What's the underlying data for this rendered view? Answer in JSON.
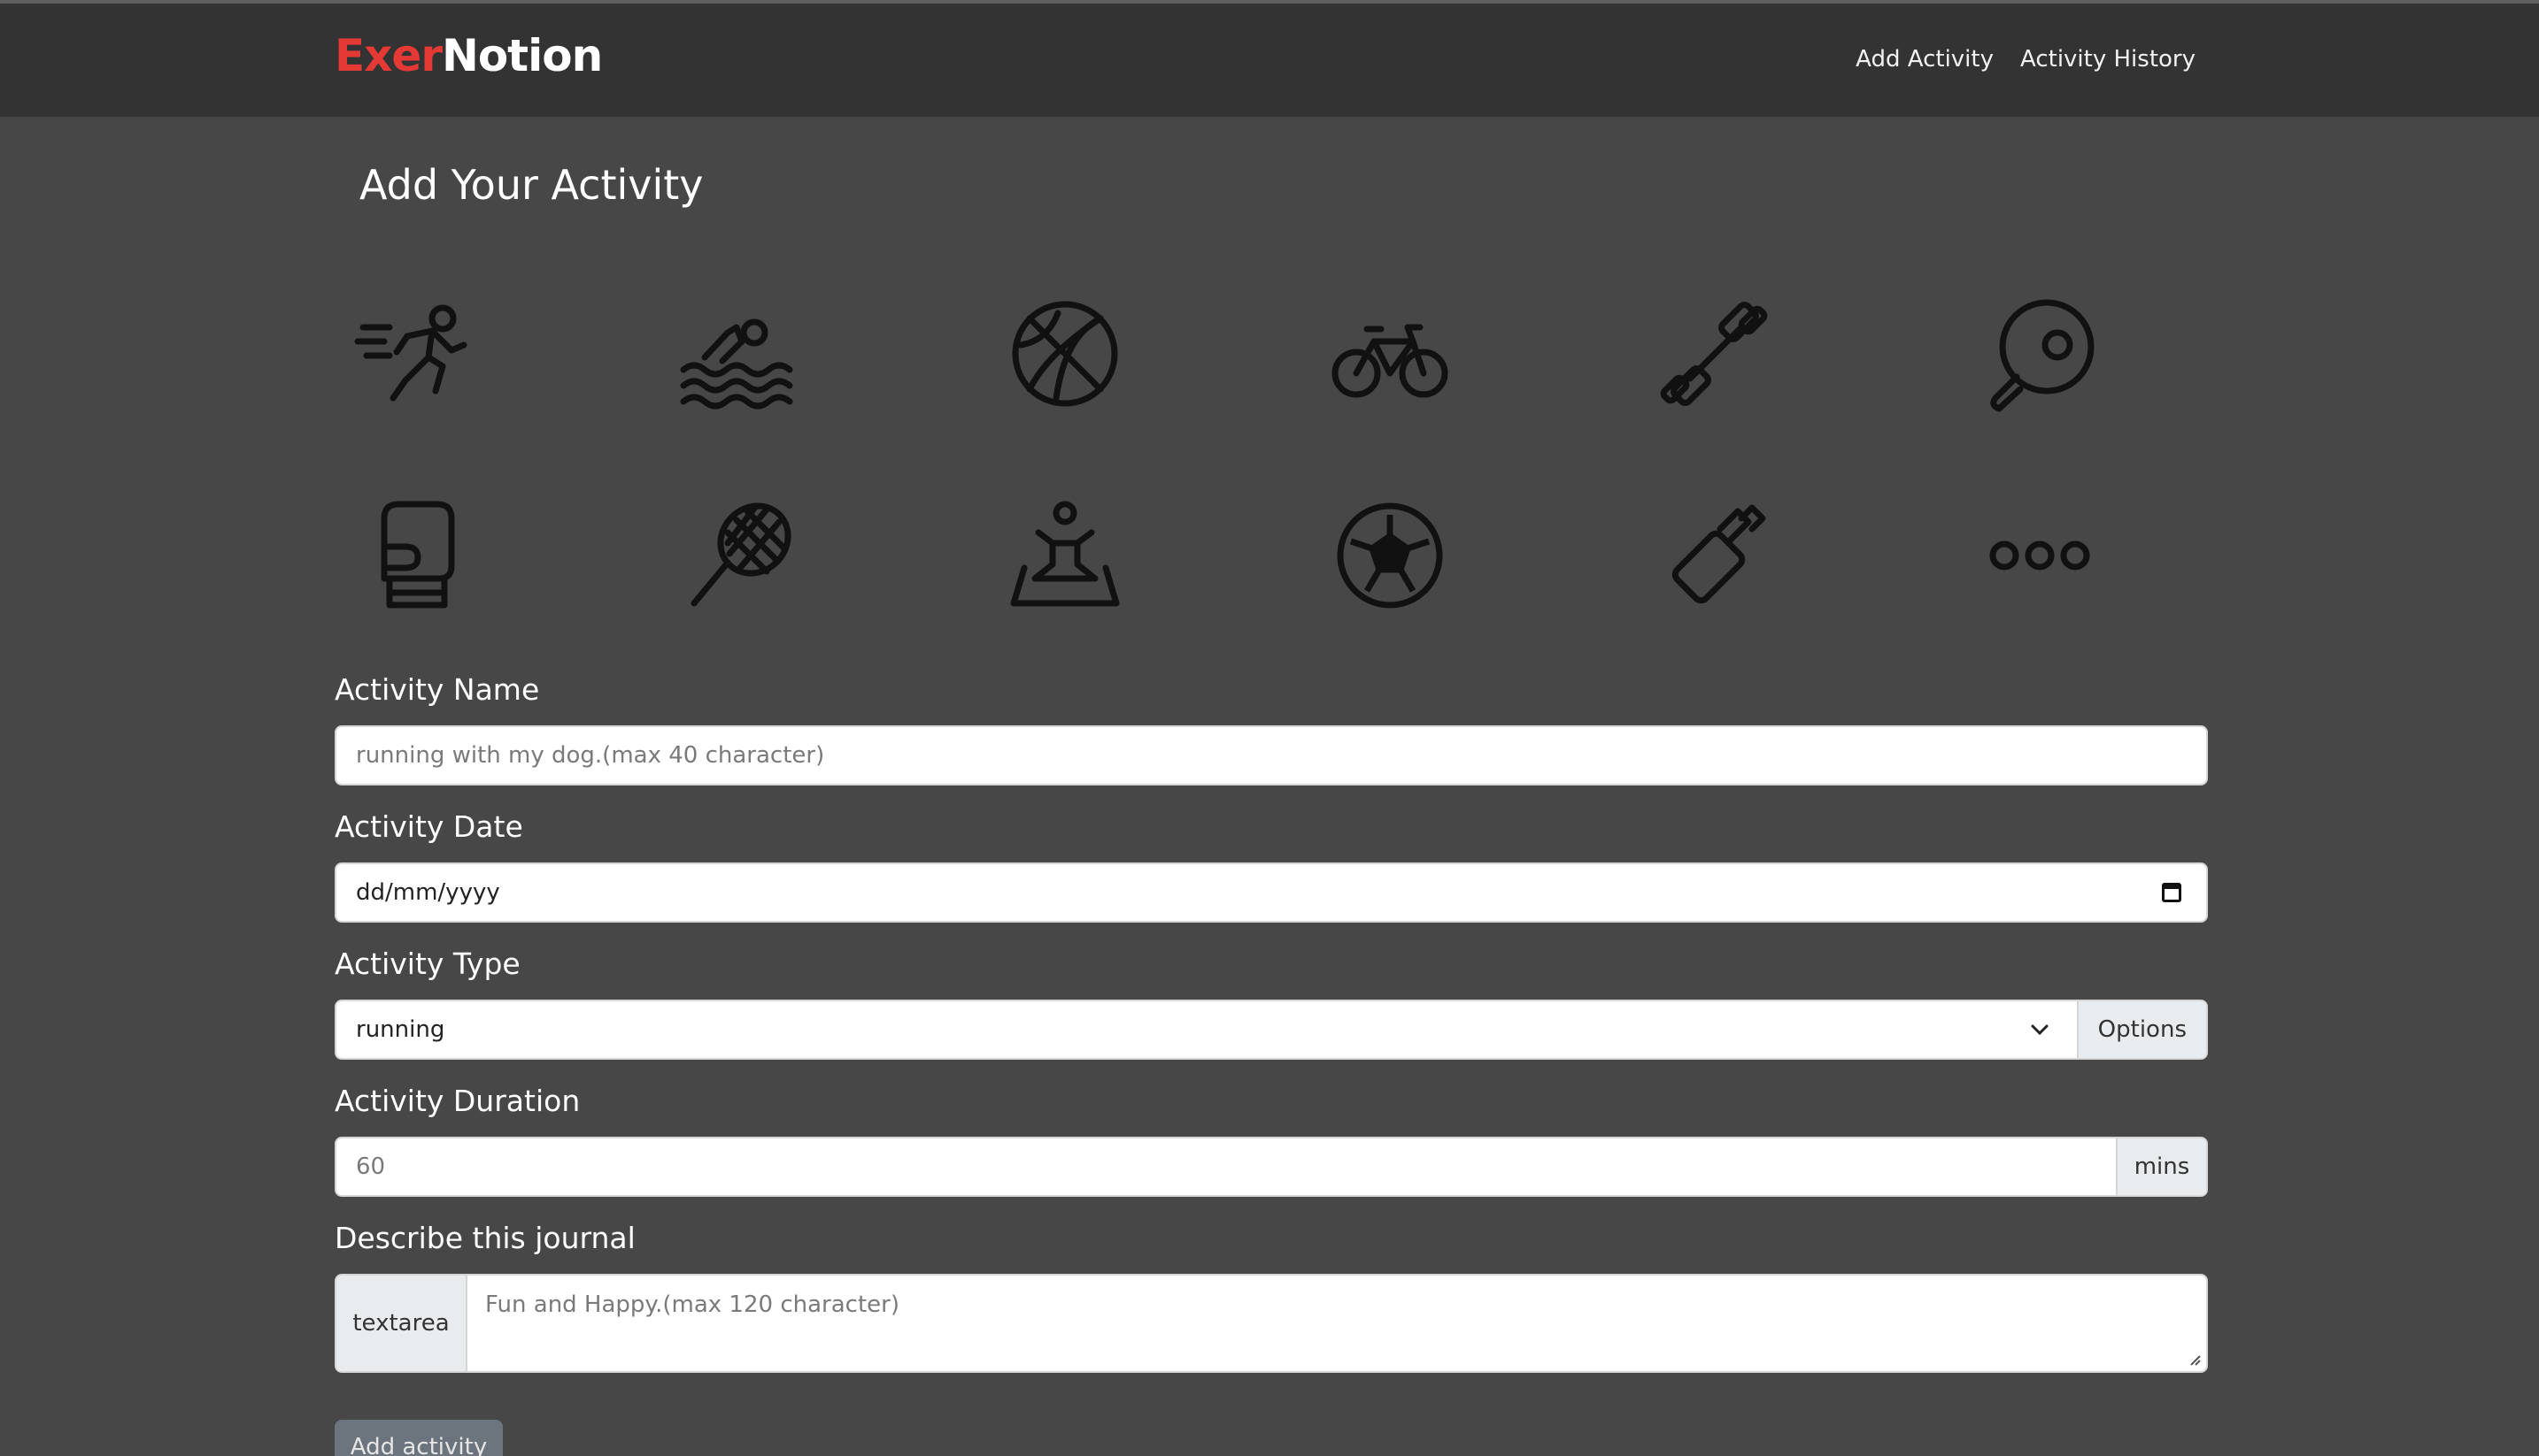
{
  "navbar": {
    "brand_part1": "Exer",
    "brand_part2": "Notion",
    "links": [
      "Add Activity",
      "Activity History"
    ]
  },
  "page_title": "Add Your Activity",
  "activity_icons": [
    "running-icon",
    "swimming-icon",
    "basketball-icon",
    "cycling-icon",
    "dumbbell-icon",
    "table-tennis-icon",
    "boxing-glove-icon",
    "badminton-icon",
    "yoga-icon",
    "soccer-ball-icon",
    "hand-grip-icon",
    "more-options-icon"
  ],
  "form": {
    "name": {
      "label": "Activity Name",
      "placeholder": "running with my dog.(max 40 character)"
    },
    "date": {
      "label": "Activity Date",
      "value": "dd/mm/yyyy"
    },
    "type": {
      "label": "Activity Type",
      "value": "running",
      "addon": "Options"
    },
    "duration": {
      "label": "Activity Duration",
      "placeholder": "60",
      "addon": "mins"
    },
    "journal": {
      "label": "Describe this journal",
      "addon": "textarea",
      "placeholder": "Fun and Happy.(max 120 character)"
    },
    "submit_label": "Add activity"
  },
  "colors": {
    "brand_red": "#e53935",
    "navbar_bg": "#333333",
    "page_bg": "#474747"
  }
}
